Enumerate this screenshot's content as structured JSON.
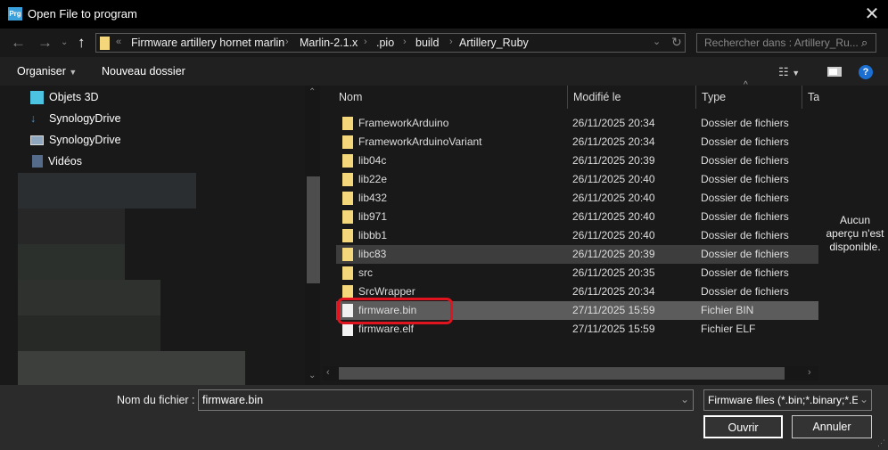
{
  "window": {
    "title": "Open File to program",
    "app_icon_text": "Prg"
  },
  "nav": {
    "breadcrumbs": [
      "Firmware artillery hornet marlin",
      "Marlin-2.1.x",
      ".pio",
      "build",
      "Artillery_Ruby"
    ],
    "overflow": "«",
    "search_placeholder": "Rechercher dans : Artillery_Ru..."
  },
  "toolbar": {
    "organize": "Organiser",
    "new_folder": "Nouveau dossier"
  },
  "sidebar": {
    "items": [
      {
        "label": "Objets 3D",
        "icon": "cube-3d-icon"
      },
      {
        "label": "SynologyDrive",
        "icon": "download-arrow-icon"
      },
      {
        "label": "SynologyDrive",
        "icon": "image-icon"
      },
      {
        "label": "Vidéos",
        "icon": "video-icon"
      }
    ]
  },
  "columns": [
    "Nom",
    "Modifié le",
    "Type",
    "Tail"
  ],
  "files": [
    {
      "name": "FrameworkArduino",
      "modified": "26/11/2025 20:34",
      "type": "Dossier de fichiers",
      "kind": "folder"
    },
    {
      "name": "FrameworkArduinoVariant",
      "modified": "26/11/2025 20:34",
      "type": "Dossier de fichiers",
      "kind": "folder"
    },
    {
      "name": "lib04c",
      "modified": "26/11/2025 20:39",
      "type": "Dossier de fichiers",
      "kind": "folder"
    },
    {
      "name": "lib22e",
      "modified": "26/11/2025 20:40",
      "type": "Dossier de fichiers",
      "kind": "folder"
    },
    {
      "name": "lib432",
      "modified": "26/11/2025 20:40",
      "type": "Dossier de fichiers",
      "kind": "folder"
    },
    {
      "name": "lib971",
      "modified": "26/11/2025 20:40",
      "type": "Dossier de fichiers",
      "kind": "folder"
    },
    {
      "name": "libbb1",
      "modified": "26/11/2025 20:40",
      "type": "Dossier de fichiers",
      "kind": "folder"
    },
    {
      "name": "libc83",
      "modified": "26/11/2025 20:39",
      "type": "Dossier de fichiers",
      "kind": "folder",
      "state": "hover"
    },
    {
      "name": "src",
      "modified": "26/11/2025 20:35",
      "type": "Dossier de fichiers",
      "kind": "folder"
    },
    {
      "name": "SrcWrapper",
      "modified": "26/11/2025 20:34",
      "type": "Dossier de fichiers",
      "kind": "folder"
    },
    {
      "name": "firmware.bin",
      "modified": "27/11/2025 15:59",
      "type": "Fichier BIN",
      "kind": "file",
      "state": "selected",
      "highlighted": true
    },
    {
      "name": "firmware.elf",
      "modified": "27/11/2025 15:59",
      "type": "Fichier ELF",
      "kind": "file"
    }
  ],
  "preview": {
    "message": "Aucun aperçu n'est disponible."
  },
  "bottom": {
    "filename_label": "Nom du fichier :",
    "filename_value": "firmware.bin",
    "filter": "Firmware files (*.bin;*.binary;*.E",
    "open": "Ouvrir",
    "cancel": "Annuler"
  },
  "colors": {
    "highlight_box": "#e0141e",
    "selected_row": "#5c5c5c",
    "hover_row": "#3d3d3d",
    "folder": "#f4d77a",
    "help": "#1a6fd1"
  }
}
